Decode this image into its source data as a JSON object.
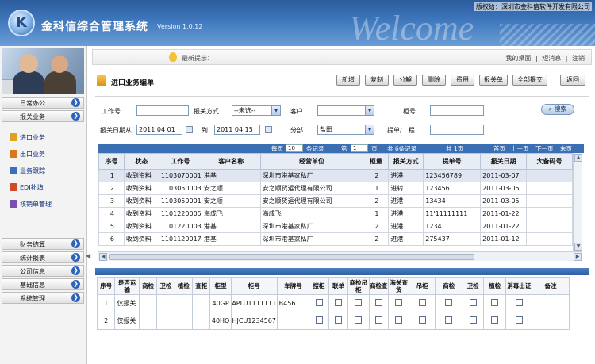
{
  "header": {
    "title": "金科信综合管理系统",
    "version": "Version 1.0.12",
    "welcome": "Welcome",
    "copyright": "版权给：深圳市金科信软件开发有限公司",
    "logo_letter": "K"
  },
  "sidebar": {
    "groups_top": [
      {
        "label": "日常办公"
      },
      {
        "label": "报关业务"
      }
    ],
    "sub_items": [
      {
        "label": "进口业务",
        "icon": "import-icon",
        "color": "#e0a020"
      },
      {
        "label": "出口业务",
        "icon": "export-icon",
        "color": "#d9771a"
      },
      {
        "label": "业务跟踪",
        "icon": "tracking-icon",
        "color": "#3a6fbf"
      },
      {
        "label": "EDI补填",
        "icon": "edi-icon",
        "color": "#d04a2a"
      },
      {
        "label": "核销单管理",
        "icon": "verification-icon",
        "color": "#7a4fb0"
      }
    ],
    "groups_bottom": [
      {
        "label": "财务结算"
      },
      {
        "label": "统计报表"
      },
      {
        "label": "公司信息"
      },
      {
        "label": "基础信息"
      },
      {
        "label": "系统管理"
      }
    ]
  },
  "notice": {
    "label": "最新提示：",
    "links": [
      "我的桌面",
      "|",
      "短消息",
      "|",
      "注销"
    ]
  },
  "page": {
    "title": "进口业务编单",
    "toolbar": [
      "新增",
      "复制",
      "分解",
      "删除",
      "费用",
      "报关单",
      "全部提交",
      "返回"
    ]
  },
  "search": {
    "work_no_label": "工作号",
    "work_no_value": "",
    "declare_mode_label": "报关方式",
    "declare_mode_value": "--未选--",
    "customer_label": "客户",
    "customer_value": "",
    "cabinet_label": "柜号",
    "cabinet_value": "",
    "date_from_label": "报关日期从",
    "date_from_value": "2011 04 01",
    "date_to_label": "到",
    "date_to_value": "2011 04 15",
    "branch_label": "分部",
    "branch_value": "盐田",
    "bill_label": "提单/二程",
    "bill_value": "",
    "search_button": "搜索"
  },
  "pager": {
    "per_page_label": "每页",
    "per_page_value": "10",
    "records_label": "条记录",
    "page_label": "第",
    "page_value": "1",
    "page_suffix": "页",
    "total_records": "共 6条记录",
    "total_pages": "共 1页",
    "first": "首页",
    "prev": "上一页",
    "next": "下一页",
    "last": "末页"
  },
  "main_table": {
    "columns": [
      "序号",
      "状态",
      "工作号",
      "客户名称",
      "经营单位",
      "柜量",
      "报关方式",
      "提单号",
      "报关日期",
      "大备码号"
    ],
    "rows": [
      [
        "1",
        "收到资料",
        "1103070001",
        "港基",
        "深圳市港基家私厂",
        "2",
        "进港",
        "123456789",
        "2011-03-07",
        ""
      ],
      [
        "2",
        "收到资料",
        "1103050003",
        "安之顺",
        "安之顺货运代理有限公司",
        "1",
        "进转",
        "123456",
        "2011-03-05",
        ""
      ],
      [
        "3",
        "收到资料",
        "1103050001",
        "安之顺",
        "安之顺货运代理有限公司",
        "2",
        "进港",
        "13434",
        "2011-03-05",
        ""
      ],
      [
        "4",
        "收到资料",
        "1101220005",
        "海成飞",
        "海成飞",
        "1",
        "进港",
        "11'11111111",
        "2011-01-22",
        ""
      ],
      [
        "5",
        "收到资料",
        "1101220003",
        "港基",
        "深圳市港基家私厂",
        "2",
        "进港",
        "1234",
        "2011-01-22",
        ""
      ],
      [
        "6",
        "收到资料",
        "1101120017",
        "港基",
        "深圳市港基家私厂",
        "2",
        "进港",
        "275437",
        "2011-01-12",
        ""
      ]
    ]
  },
  "detail_table": {
    "columns": [
      "序号",
      "是否运输",
      "商检",
      "卫检",
      "植检",
      "查柜",
      "柜型",
      "柜号",
      "车牌号",
      "搜柜",
      "联单",
      "商检吊柜",
      "商检查",
      "海关查货",
      "吊柜",
      "商检",
      "卫检",
      "植检",
      "消毒出证",
      "备注"
    ],
    "rows": [
      {
        "no": "1",
        "transport": "仅报关",
        "type": "40GP",
        "cabinet_no": "APLU1111111",
        "plate": "B456"
      },
      {
        "no": "2",
        "transport": "仅报关",
        "type": "40HQ",
        "cabinet_no": "HJCU1234567",
        "plate": ""
      }
    ]
  }
}
